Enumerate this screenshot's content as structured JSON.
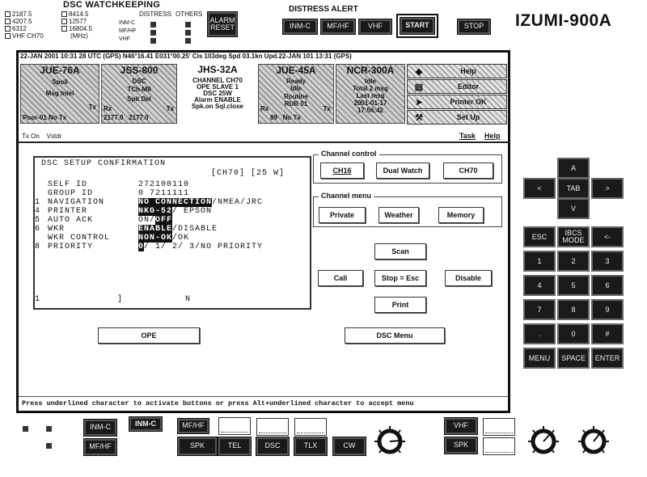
{
  "watchkeeping": {
    "title": "DSC WATCHKEEPING",
    "frequencies_col1": [
      "2187.5",
      "4207.5",
      "6312",
      "VHF CH70"
    ],
    "frequencies_col2": [
      "8414.5",
      "12577",
      "16804.5",
      "(MHz)"
    ],
    "headers": {
      "distress": "DISTRESS",
      "others": "OTHERS"
    },
    "rows": [
      "INM-C",
      "MF/HF",
      "VHF"
    ],
    "alarm_reset": "ALARM RESET"
  },
  "distress_alert": {
    "title": "DISTRESS ALERT",
    "buttons": [
      "INM-C",
      "MF/HF",
      "VHF",
      "START"
    ],
    "stop": "STOP"
  },
  "model": "IZUMI-900A",
  "window": {
    "status_top": "22-JAN 2001 10:31 28 UTC (GPS)     N46°16.41 E031°00.25' Cis 103deg Spd 03.1kn Upd.22-JAN 101 13:31 (GPS)",
    "panes": [
      {
        "title": "JUE-76A",
        "lines": [
          "Spoil",
          "Msg Intel"
        ],
        "rx": "",
        "tx": "Tx",
        "footer": "Poor-01  No Tx"
      },
      {
        "title": "JSS-800",
        "lines": [
          "DSC",
          "TCh-M8",
          "Spit Del"
        ],
        "rx": "Rx",
        "tx": "Tx",
        "footer": "2177.0   2177.0"
      },
      {
        "title": "JHS-32A",
        "lines": [
          "CHANNEL   CH70",
          "OPE   SLAVE 1",
          "DSC        25W",
          "Alarm ENABLE",
          "Spk.on   Sql.close"
        ]
      },
      {
        "title": "JUE-45A",
        "lines": [
          "Ready",
          "Idle",
          "Routine",
          "RUR 01"
        ],
        "rx": "Rx",
        "tx": "Tx",
        "footer": "89   No Tx"
      },
      {
        "title": "NCR-300A",
        "lines": [
          "Idle",
          "Total 2 msg",
          "Last msg",
          "2001-01-17",
          "17:56:42"
        ]
      }
    ],
    "side_buttons": [
      {
        "icon": "help-icon",
        "label": "Help"
      },
      {
        "icon": "editor-icon",
        "label": "Editor"
      },
      {
        "icon": "printer-icon",
        "label": "Printer OK"
      },
      {
        "icon": "setup-icon",
        "label": "Set Up"
      }
    ],
    "menubar": {
      "left": "Tx On    Vstdr",
      "task": "Task",
      "help": "Help"
    },
    "setup": {
      "title": "DSC SETUP CONFIRMATION",
      "channel": "[CH70]   [25 W]",
      "rows": [
        {
          "num": "",
          "label": "SELF ID",
          "value_plain": "272100110",
          "value_hl": "",
          "value_rest": ""
        },
        {
          "num": "",
          "label": "GROUP ID",
          "value_plain": "0 7211111",
          "value_hl": "",
          "value_rest": ""
        },
        {
          "num": "1",
          "label": "NAVIGATION",
          "value_plain": "",
          "value_hl": "NO CONNECTION",
          "value_rest": "/NMEA/JRC"
        },
        {
          "num": "4",
          "label": "PRINTER",
          "value_plain": "",
          "value_hl": "NKG-52",
          "value_rest": "/ EPSON"
        },
        {
          "num": "5",
          "label": "AUTO ACK",
          "value_plain": "ON/",
          "value_hl": "OFF",
          "value_rest": ""
        },
        {
          "num": "6",
          "label": "WKR",
          "value_plain": "",
          "value_hl": "ENABLE",
          "value_rest": "/DISABLE"
        },
        {
          "num": "",
          "label": "WKR CONTROL",
          "value_plain": "",
          "value_hl": "NON-OK",
          "value_rest": "/OK"
        },
        {
          "num": "8",
          "label": "PRIORITY",
          "value_plain": "",
          "value_hl": "0",
          "value_rest": "/ 1/ 2/ 3/NO PRIORITY"
        }
      ],
      "footer_left": "1",
      "footer_mid": "]",
      "footer_right": "N"
    },
    "channel_control": {
      "title": "Channel control",
      "buttons": [
        "CH16",
        "Dual Watch",
        "CH70"
      ]
    },
    "channel_menu": {
      "title": "Channel menu",
      "buttons": [
        "Private",
        "Weather",
        "Memory"
      ]
    },
    "actions": {
      "scan": "Scan",
      "call": "Call",
      "stop_esc": "Stop = Esc",
      "disable": "Disable",
      "print": "Print"
    },
    "ope": "OPE",
    "dsc_menu": "DSC Menu",
    "status_line": "Press underlined character to activate buttons or press Alt+underlined character to accept menu"
  },
  "keypad": {
    "arrows": {
      "up": "A",
      "left": "<",
      "center": "TAB",
      "right": ">",
      "down": "V"
    },
    "row1": [
      "ESC",
      "IBCS MODE",
      "<-"
    ],
    "numbers": [
      [
        "1",
        "2",
        "3"
      ],
      [
        "4",
        "5",
        "6"
      ],
      [
        "7",
        "8",
        "9"
      ],
      [
        ".",
        "0",
        "#"
      ]
    ],
    "bottom": [
      "MENU",
      "SPACE",
      "ENTER"
    ]
  },
  "bottom_panel": {
    "buttons_left": [
      "INM-C",
      "MF/HF"
    ],
    "inmc_indicator": "INM-C",
    "mfhf_indicator": "MF/HF",
    "channel_buttons": [
      "SPK",
      "TEL",
      "DSC",
      "TLX",
      "CW"
    ],
    "vhf": "VHF",
    "vhf_spk": "SPK"
  }
}
